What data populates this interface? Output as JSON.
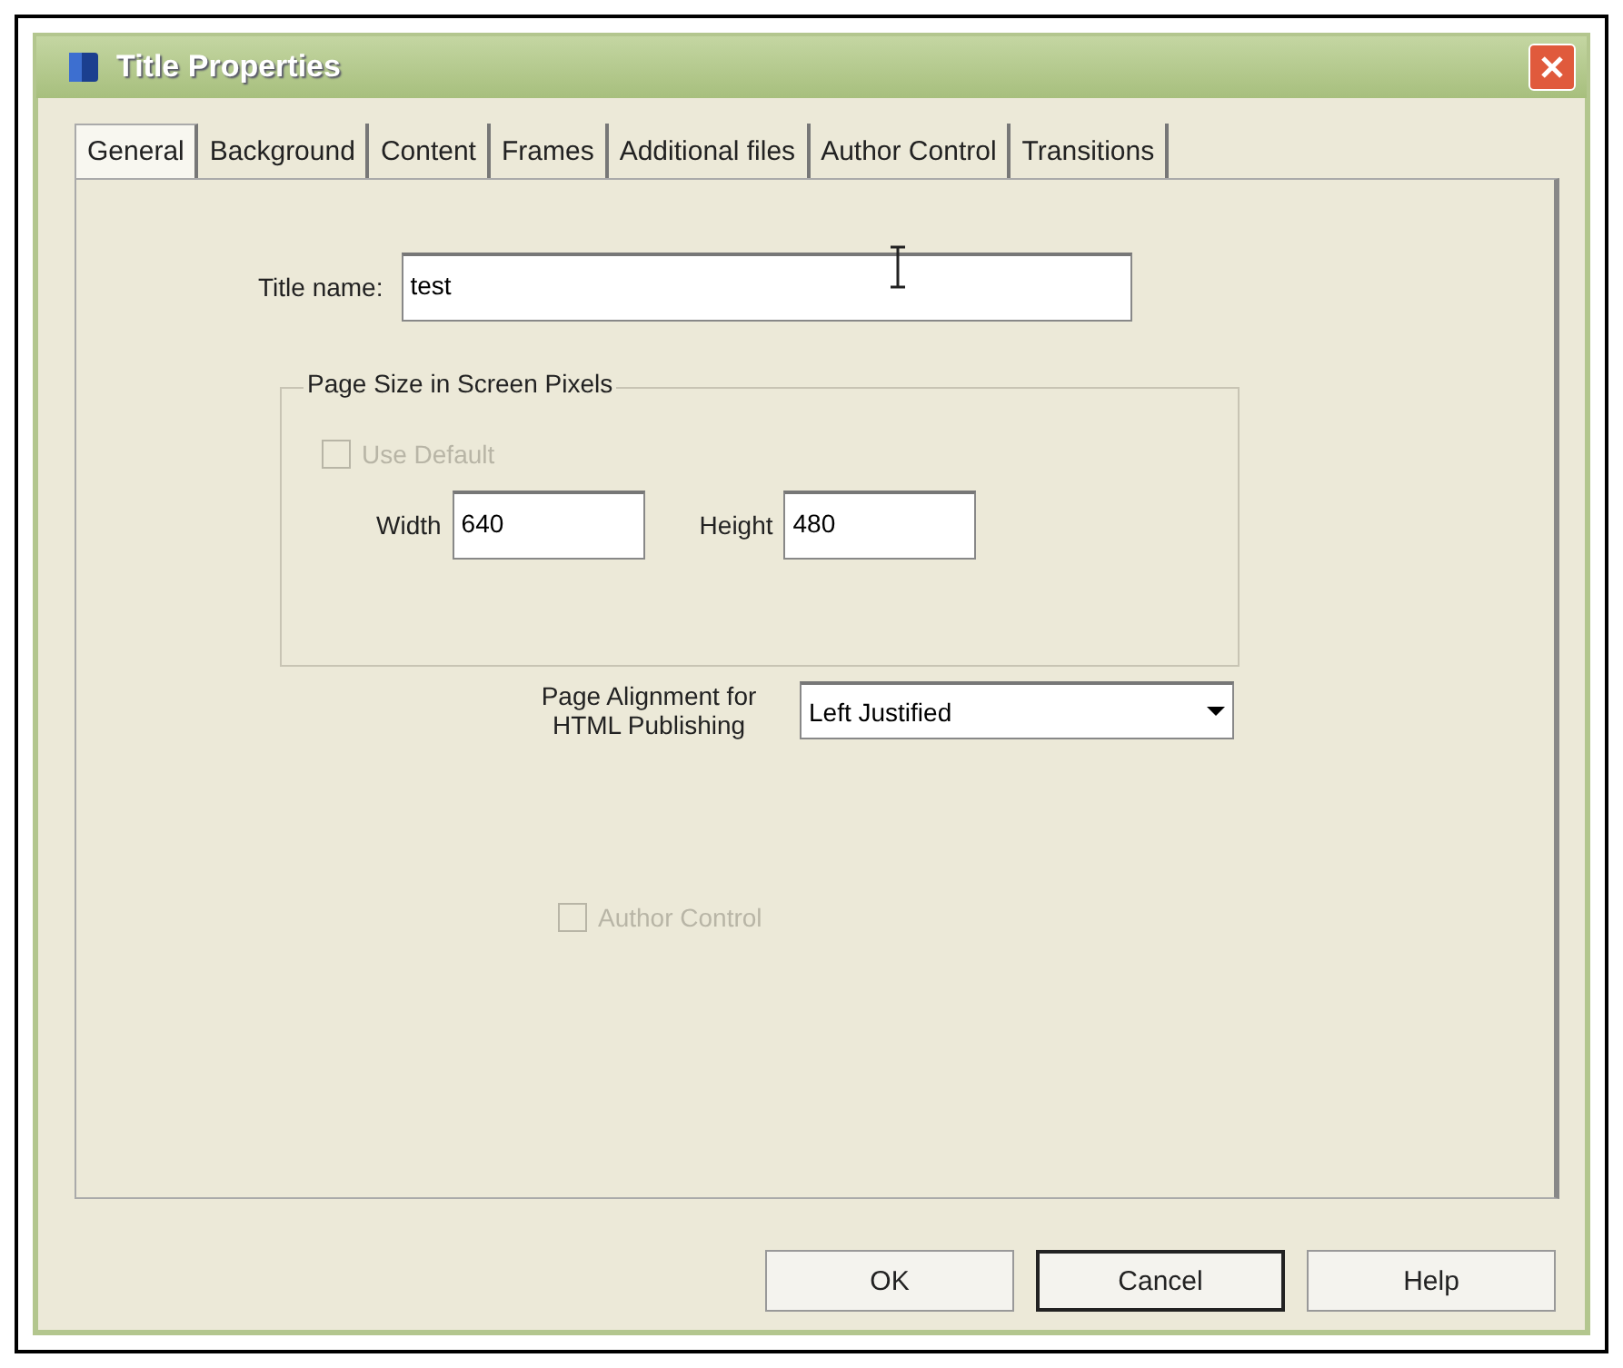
{
  "window": {
    "title": "Title Properties"
  },
  "tabs": [
    {
      "label": "General",
      "selected": true
    },
    {
      "label": "Background",
      "selected": false
    },
    {
      "label": "Content",
      "selected": false
    },
    {
      "label": "Frames",
      "selected": false
    },
    {
      "label": "Additional files",
      "selected": false
    },
    {
      "label": "Author Control",
      "selected": false
    },
    {
      "label": "Transitions",
      "selected": false
    }
  ],
  "title_name": {
    "label": "Title name:",
    "value": "test"
  },
  "page_size": {
    "legend": "Page Size in Screen Pixels",
    "use_default": {
      "label": "Use Default",
      "checked": false,
      "disabled": true
    },
    "width": {
      "label": "Width",
      "value": "640"
    },
    "height": {
      "label": "Height",
      "value": "480"
    }
  },
  "page_alignment": {
    "label": "Page Alignment for HTML Publishing",
    "value": "Left Justified"
  },
  "author_control": {
    "label": "Author Control",
    "checked": false,
    "disabled": true
  },
  "buttons": [
    {
      "label": "OK",
      "default": false
    },
    {
      "label": "Cancel",
      "default": true
    },
    {
      "label": "Help",
      "default": false
    }
  ]
}
